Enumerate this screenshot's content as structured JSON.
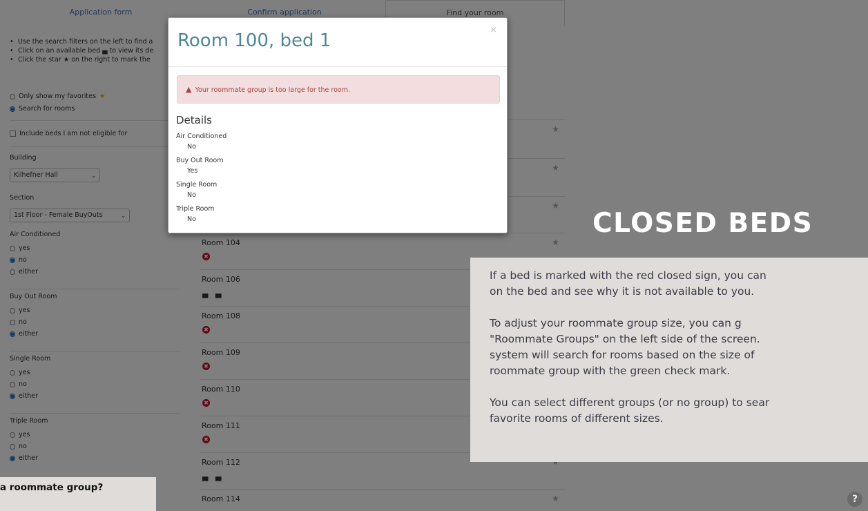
{
  "tabs": [
    "Application form",
    "Confirm application",
    "Find your room"
  ],
  "instructions": [
    "Use the search filters on the left to find a",
    "Click on an available bed ▄ to view its de",
    "Click the star ★ on the right to mark the"
  ],
  "mode": {
    "favorites_label": "Only show my favorites",
    "search_label": "Search for rooms",
    "include_label": "Include beds I am not eligible for"
  },
  "filters": {
    "building_label": "Building",
    "building_value": "Kilhefner Hall",
    "section_label": "Section",
    "section_value": "1st Floor - Female BuyOuts",
    "groups": [
      {
        "label": "Air Conditioned",
        "options": [
          "yes",
          "no",
          "either"
        ],
        "selected": "no"
      },
      {
        "label": "Buy Out Room",
        "options": [
          "yes",
          "no",
          "either"
        ],
        "selected": "either"
      },
      {
        "label": "Single Room",
        "options": [
          "yes",
          "no",
          "either"
        ],
        "selected": "either"
      },
      {
        "label": "Triple Room",
        "options": [
          "yes",
          "no",
          "either"
        ],
        "selected": "either"
      }
    ]
  },
  "rooms": [
    {
      "name": "Room 104",
      "status": "closed"
    },
    {
      "name": "Room 106",
      "status": "beds"
    },
    {
      "name": "Room 108",
      "status": "closed"
    },
    {
      "name": "Room 109",
      "status": "closed"
    },
    {
      "name": "Room 110",
      "status": "closed"
    },
    {
      "name": "Room 111",
      "status": "closed"
    },
    {
      "name": "Room 112",
      "status": "beds"
    },
    {
      "name": "Room 114",
      "status": "none"
    }
  ],
  "modal": {
    "title": "Room 100, bed 1",
    "close": "×",
    "alert": "Your roommate group is too large for the room.",
    "details_heading": "Details",
    "details": [
      {
        "label": "Air Conditioned",
        "value": "No"
      },
      {
        "label": "Buy Out Room",
        "value": "Yes"
      },
      {
        "label": "Single Room",
        "value": "No"
      },
      {
        "label": "Triple Room",
        "value": "No"
      }
    ]
  },
  "overlay": {
    "heading": "CLOSED BEDS",
    "paragraphs": [
      "If a bed is marked with the red closed sign, you can",
      "on the bed and see why it is not available to you.",
      "To adjust your roommate group size, you can g",
      "\"Roommate Groups\" on the left side of the screen.",
      "system will search for rooms based on the size of",
      "roommate group with the green check mark.",
      "You can select different groups (or no group) to sear",
      "favorite rooms of different sizes."
    ],
    "callout": "a roommate group?",
    "help": "?"
  },
  "icons": {
    "star": "★",
    "bed": "▄",
    "closed": "✖",
    "warning": "▲",
    "caret": "⌄"
  },
  "colors": {
    "accent": "#3b73b9",
    "title": "#4e8798",
    "closed": "#c8102e",
    "alert_bg": "#f2dede",
    "alert_text": "#a94442",
    "panel": "#dfdcd9"
  }
}
